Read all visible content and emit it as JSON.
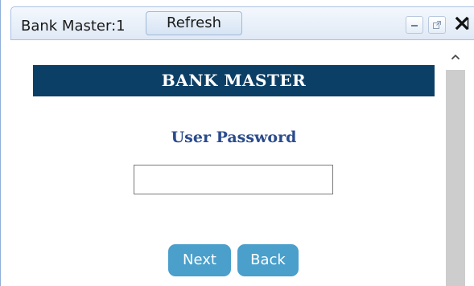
{
  "window": {
    "title": "Bank Master:1",
    "refresh_label": "Refresh",
    "controls": {
      "minimize_icon": "minimize-icon",
      "popout_icon": "popout-icon",
      "close_icon": "close-icon"
    }
  },
  "form": {
    "header": "BANK MASTER",
    "password_label": "User Password",
    "password_value": "",
    "next_label": "Next",
    "back_label": "Back"
  },
  "colors": {
    "header_bg": "#0c3f66",
    "label_color": "#2a4b8d",
    "button_bg": "#4a9fcb"
  }
}
